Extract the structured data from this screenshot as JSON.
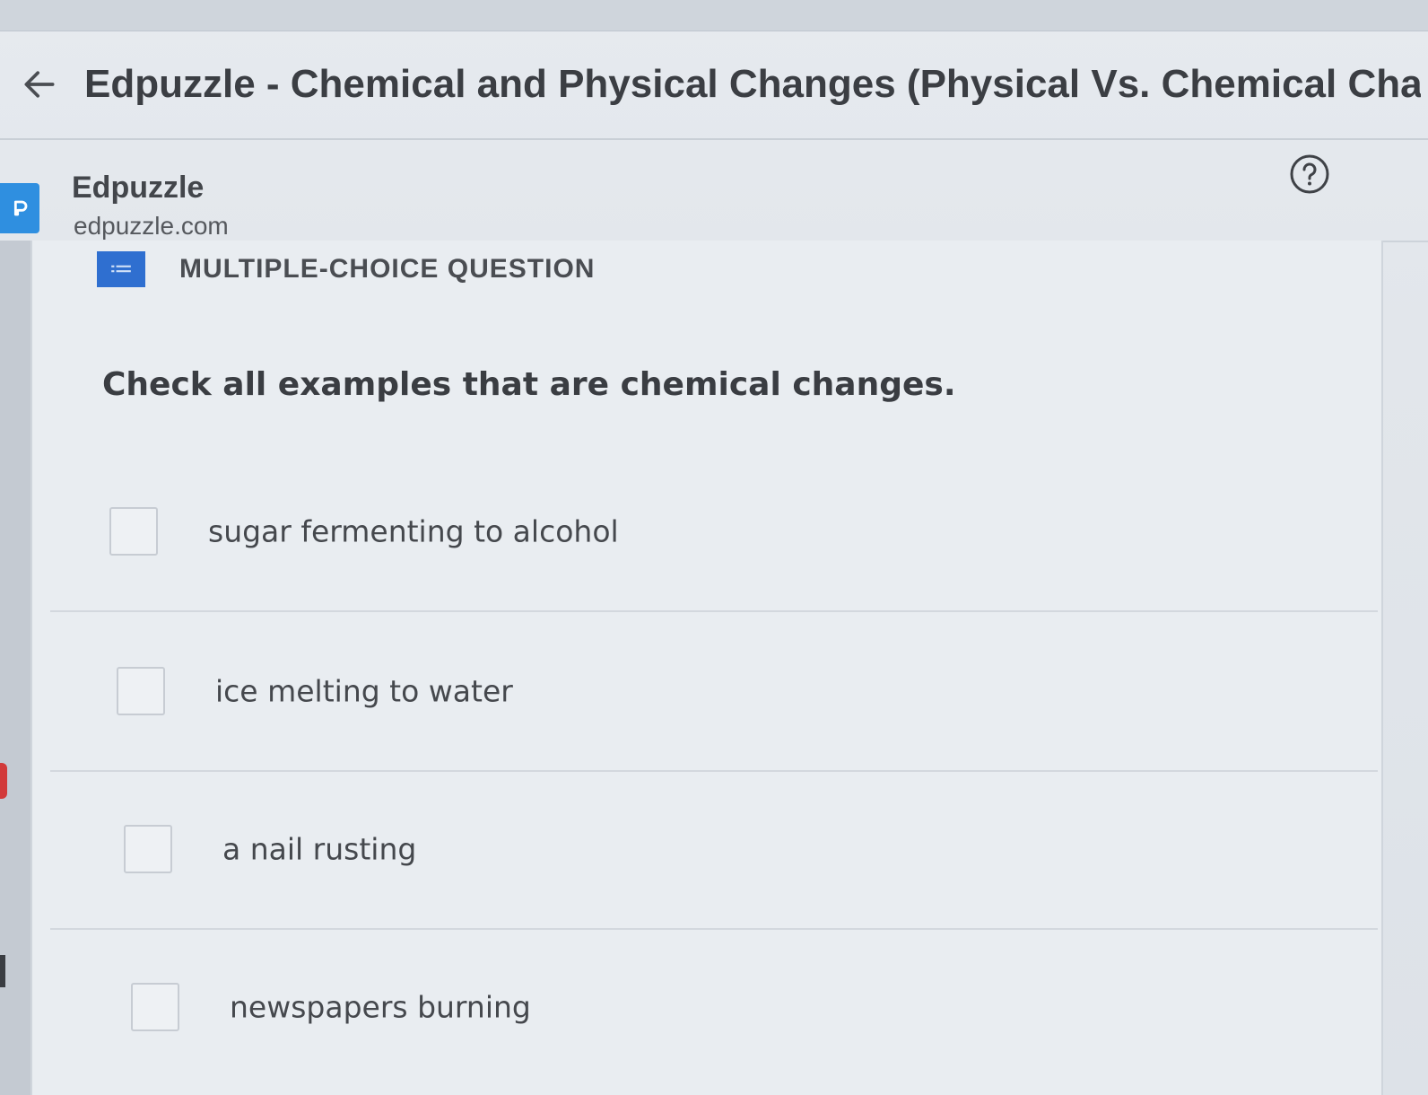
{
  "header": {
    "back_icon": "arrow-left-icon",
    "title": "Edpuzzle - Chemical and Physical Changes (Physical Vs. Chemical Changes - Ex"
  },
  "site": {
    "logo_icon": "edpuzzle-logo-icon",
    "name": "Edpuzzle",
    "domain": "edpuzzle.com",
    "help_icon": "help-circle-icon"
  },
  "question": {
    "type_icon": "list-icon",
    "type_label": "MULTIPLE-CHOICE QUESTION",
    "prompt": "Check all examples that are chemical changes.",
    "options": [
      {
        "label": "sugar fermenting to alcohol",
        "checked": false
      },
      {
        "label": "ice melting to water",
        "checked": false
      },
      {
        "label": "a nail rusting",
        "checked": false
      },
      {
        "label": "newspapers burning",
        "checked": false
      }
    ]
  },
  "colors": {
    "accent": "#2f6fd0",
    "brand": "#2f8fe0",
    "text": "#3a3d42"
  }
}
